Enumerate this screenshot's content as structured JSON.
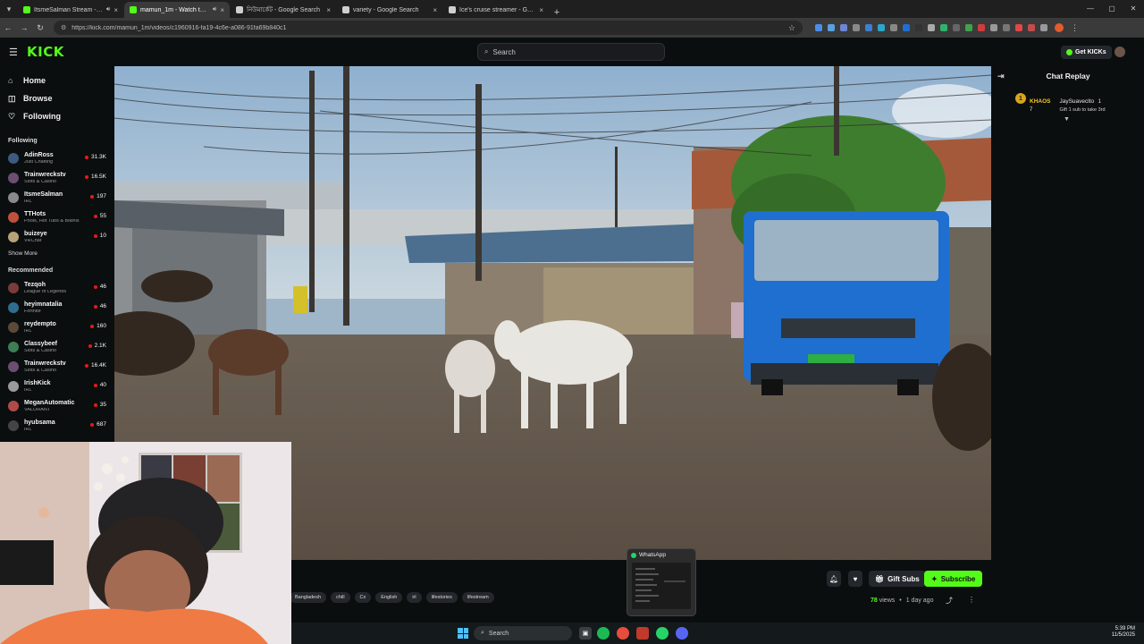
{
  "browser": {
    "tabs": [
      {
        "title": "ItsmeSalman Stream - Wat",
        "favicon_color": "#53fc18",
        "active": false,
        "audio": true
      },
      {
        "title": "mamun_1m - Watch the V",
        "favicon_color": "#53fc18",
        "active": true,
        "audio": true
      },
      {
        "title": "নিউমার্কেট - Google Search",
        "favicon_color": "#cfcfcf",
        "active": false,
        "audio": false
      },
      {
        "title": "variety - Google Search",
        "favicon_color": "#cfcfcf",
        "active": false,
        "audio": false
      },
      {
        "title": "Ice's cruise streamer - Google S",
        "favicon_color": "#cfcfcf",
        "active": false,
        "audio": false
      }
    ],
    "url": "https://kick.com/mamun_1m/videos/c1960916-fa19-4c6e-a086-91fa69b840c1"
  },
  "header": {
    "logo": "KICK",
    "search_placeholder": "Search",
    "get_kicks_label": "Get KICKs"
  },
  "sidebar": {
    "nav": [
      {
        "label": "Home",
        "icon": "home-icon",
        "glyph": "⌂"
      },
      {
        "label": "Browse",
        "icon": "browse-icon",
        "glyph": "◫"
      },
      {
        "label": "Following",
        "icon": "heart-icon",
        "glyph": "♡"
      }
    ],
    "following_title": "Following",
    "following": [
      {
        "name": "AdinRoss",
        "category": "Just Chatting",
        "viewers": "31.3K",
        "color": "#3d5a80"
      },
      {
        "name": "Trainwreckstv",
        "category": "Slots & Casino",
        "viewers": "16.5K",
        "color": "#6b4e71"
      },
      {
        "name": "ItsmeSalman",
        "category": "IRL",
        "viewers": "197",
        "color": "#8a8a8a"
      },
      {
        "name": "TTHots",
        "category": "Pools, Hot Tubs & Bikinis",
        "viewers": "55",
        "color": "#c0503c"
      },
      {
        "name": "buizeye",
        "category": "VRChat",
        "viewers": "10",
        "color": "#b8a27a"
      }
    ],
    "show_more": "Show More",
    "recommended_title": "Recommended",
    "recommended": [
      {
        "name": "Tezqoh",
        "category": "League of Legends",
        "viewers": "46",
        "color": "#7a3b3b"
      },
      {
        "name": "heyimnatalia",
        "category": "Fortnite",
        "viewers": "46",
        "color": "#2f6d8f"
      },
      {
        "name": "reydempto",
        "category": "IRL",
        "viewers": "160",
        "color": "#5b4a3a"
      },
      {
        "name": "Classybeef",
        "category": "Slots & Casino",
        "viewers": "2.1K",
        "color": "#3e7d55"
      },
      {
        "name": "Trainwreckstv",
        "category": "Slots & Casino",
        "viewers": "16.4K",
        "color": "#6b4e71"
      },
      {
        "name": "IrishKick",
        "category": "IRL",
        "viewers": "40",
        "color": "#9a9a9a"
      },
      {
        "name": "MeganAutomatic",
        "category": "VALORANT",
        "viewers": "35",
        "color": "#b04a4a"
      },
      {
        "name": "hyubsama",
        "category": "IRL",
        "viewers": "687",
        "color": "#444"
      }
    ]
  },
  "chat": {
    "title": "Chat Replay",
    "message": {
      "coin": "1",
      "username": "KHAOS",
      "count": "7",
      "recipient": "JaySuaveclto",
      "recipient_count": "1",
      "text": "Gift 1 sub to take 3rd"
    }
  },
  "video_info": {
    "tags": [
      "Bangladesh",
      "chill",
      "Cx",
      "English",
      "irl",
      "lifestories",
      "lifestream"
    ],
    "gift_subs_label": "Gift Subs",
    "subscribe_label": "Subscribe",
    "views_count": "78",
    "views_label": "views",
    "separator": "•",
    "time_ago": "1 day ago"
  },
  "whatsapp_preview": {
    "title": "WhatsApp"
  },
  "taskbar": {
    "search_placeholder": "Search",
    "time": "5:39 PM",
    "date": "11/5/2025"
  }
}
